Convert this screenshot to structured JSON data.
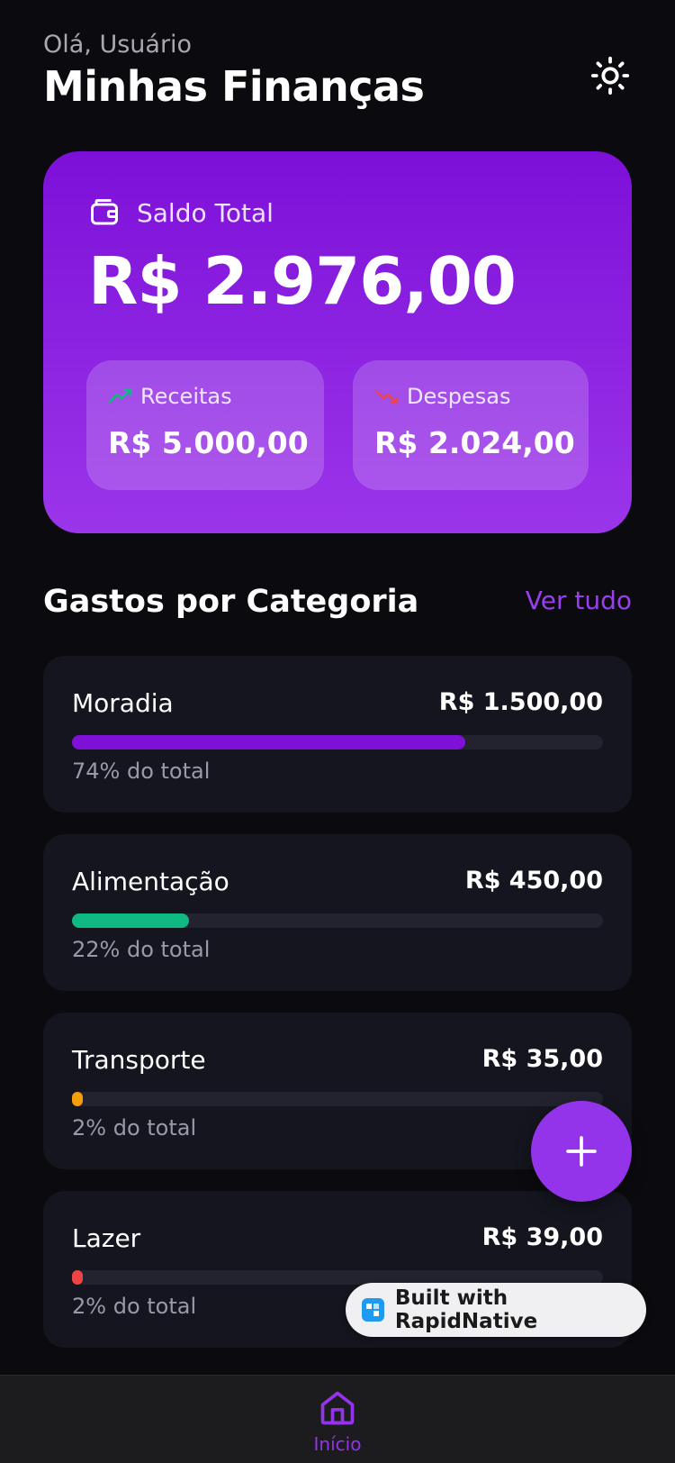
{
  "header": {
    "greeting": "Olá, Usuário",
    "title": "Minhas Finanças",
    "theme_icon": "sun-icon"
  },
  "balance": {
    "label": "Saldo Total",
    "value": "R$ 2.976,00",
    "icon": "wallet-icon",
    "income": {
      "label": "Receitas",
      "value": "R$ 5.000,00",
      "icon": "trending-up-icon",
      "color": "#10b981"
    },
    "expense": {
      "label": "Despesas",
      "value": "R$ 2.024,00",
      "icon": "trending-down-icon",
      "color": "#ef4444"
    }
  },
  "categories_section": {
    "title": "Gastos por Categoria",
    "see_all": "Ver tudo",
    "items": [
      {
        "name": "Moradia",
        "amount": "R$ 1.500,00",
        "pct_label": "74% do total",
        "pct": 74,
        "color": "#7e10d8"
      },
      {
        "name": "Alimentação",
        "amount": "R$ 450,00",
        "pct_label": "22% do total",
        "pct": 22,
        "color": "#10b981"
      },
      {
        "name": "Transporte",
        "amount": "R$ 35,00",
        "pct_label": "2% do total",
        "pct": 2,
        "color": "#f59e0b"
      },
      {
        "name": "Lazer",
        "amount": "R$ 39,00",
        "pct_label": "2% do total",
        "pct": 2,
        "color": "#ef4444"
      }
    ]
  },
  "fab": {
    "icon": "plus-icon"
  },
  "badge": {
    "text": "Built with RapidNative"
  },
  "nav": {
    "home_label": "Início",
    "home_icon": "home-icon"
  },
  "colors": {
    "accent": "#9333ea",
    "background": "#0b0b0f",
    "card": "#15151f"
  }
}
